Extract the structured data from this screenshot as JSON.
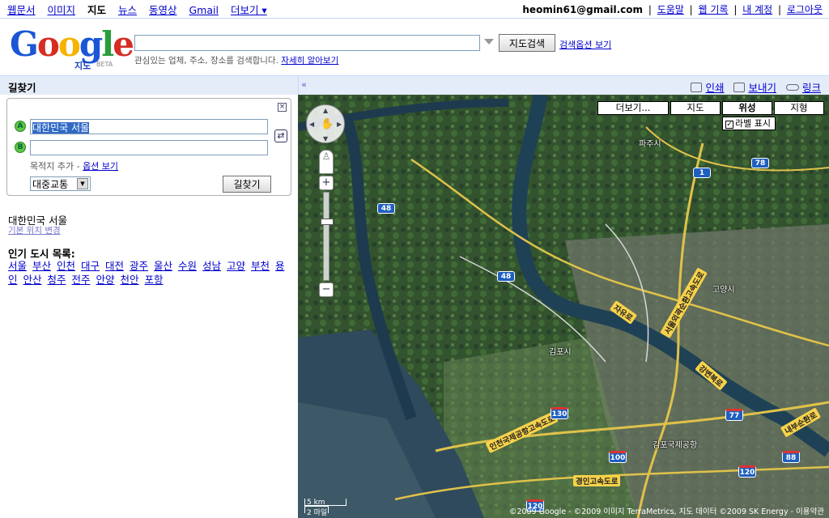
{
  "topnav": {
    "links": [
      "웹문서",
      "이미지",
      "지도",
      "뉴스",
      "동영상",
      "Gmail",
      "더보기 ▾"
    ],
    "active": "지도",
    "email": "heomin61@gmail.com",
    "right_links": [
      "도움말",
      "웹 기록",
      "내 계정",
      "로그아웃"
    ]
  },
  "logo": {
    "text": "Google",
    "sub": "지도",
    "beta": "BETA"
  },
  "search": {
    "value": "",
    "button": "지도검색",
    "options_link": "검색옵션 보기",
    "hint": "관심있는 업체, 주소, 장소를 검색합니다.",
    "hint_link": "자세히 알아보기"
  },
  "panel": {
    "title": "길찾기",
    "collapse": "«",
    "actions": [
      "인쇄",
      "보내기",
      "링크"
    ]
  },
  "directions": {
    "marker_a": "A",
    "marker_b": "B",
    "from_value": "대한민국 서울",
    "to_value": "",
    "add_dest": "목적지 추가 - ",
    "options_link": "옵션 보기",
    "mode": "대중교통",
    "go_button": "길찾기",
    "close": "×",
    "swap": "⇄"
  },
  "location": {
    "name": "대한민국 서울",
    "change_link": "기본 위치 변경"
  },
  "popular": {
    "title": "인기 도시 목록:",
    "cities": [
      "서울",
      "부산",
      "인천",
      "대구",
      "대전",
      "광주",
      "울산",
      "수원",
      "성남",
      "고양",
      "부천",
      "용인",
      "안산",
      "청주",
      "전주",
      "안양",
      "천안",
      "포항"
    ]
  },
  "map": {
    "types": [
      "더보기...",
      "지도",
      "위성",
      "지형"
    ],
    "active_type": "위성",
    "labels_toggle": "라벨 표시",
    "labels_checked": true,
    "scale_km": "5 km",
    "scale_mi": "2 마일",
    "copyright": "©2009 Google - ©2009 이미지 TerraMetrics, 지도 데이터 ©2009 SK Energy - 이용약관",
    "places": [
      "파주시",
      "고양시",
      "김포시",
      "김포국제공항"
    ],
    "roads": [
      "자유로",
      "서울외곽순환고속도로",
      "강변북로",
      "인천국제공항고속도로",
      "경인고속도로",
      "내부순환로"
    ],
    "shields": [
      "48",
      "48",
      "1",
      "78",
      "130",
      "100",
      "77",
      "120",
      "88",
      "120"
    ]
  }
}
